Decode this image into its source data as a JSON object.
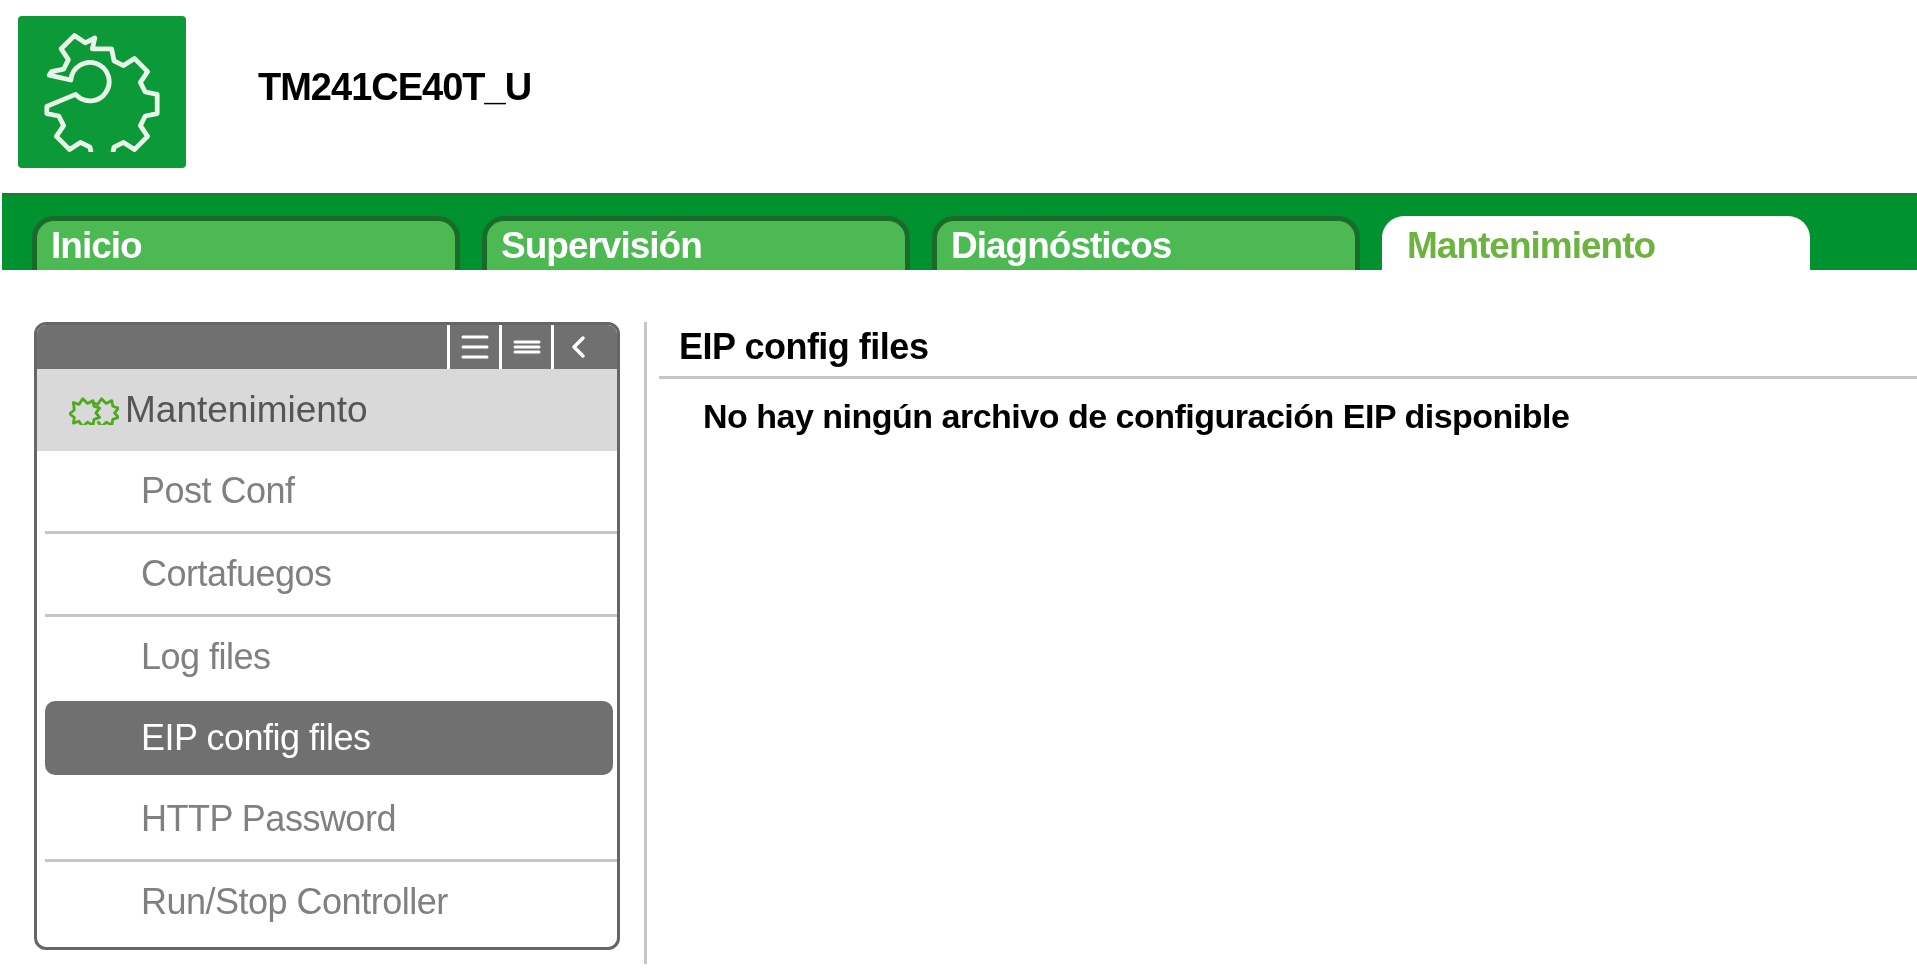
{
  "header": {
    "device_name": "TM241CE40T_U"
  },
  "tabs": [
    {
      "label": "Inicio",
      "selected": false
    },
    {
      "label": "Supervisión",
      "selected": false
    },
    {
      "label": "Diagnósticos",
      "selected": false
    },
    {
      "label": "Mantenimiento",
      "selected": true
    }
  ],
  "sidebar": {
    "section": "Mantenimiento",
    "items": [
      {
        "label": "Post Conf",
        "selected": false
      },
      {
        "label": "Cortafuegos",
        "selected": false
      },
      {
        "label": "Log files",
        "selected": false
      },
      {
        "label": "EIP config files",
        "selected": true
      },
      {
        "label": "HTTP Password",
        "selected": false
      },
      {
        "label": "Run/Stop Controller",
        "selected": false
      }
    ]
  },
  "content": {
    "title": "EIP config files",
    "message": "No hay ningún archivo de configuración EIP disponible"
  }
}
